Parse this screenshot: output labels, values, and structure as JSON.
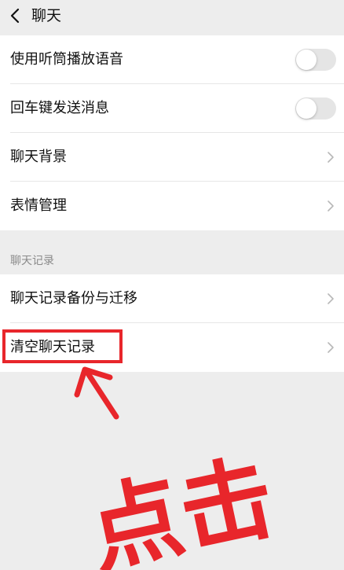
{
  "header": {
    "title": "聊天"
  },
  "settings": {
    "items": [
      {
        "label": "使用听筒播放语音",
        "toggle_on": false
      },
      {
        "label": "回车键发送消息",
        "toggle_on": false
      },
      {
        "label": "聊天背景"
      },
      {
        "label": "表情管理"
      }
    ]
  },
  "history": {
    "section_title": "聊天记录",
    "items": [
      {
        "label": "聊天记录备份与迁移"
      },
      {
        "label": "清空聊天记录"
      }
    ]
  },
  "annotation": {
    "text": "点击",
    "color": "#e8262b"
  }
}
